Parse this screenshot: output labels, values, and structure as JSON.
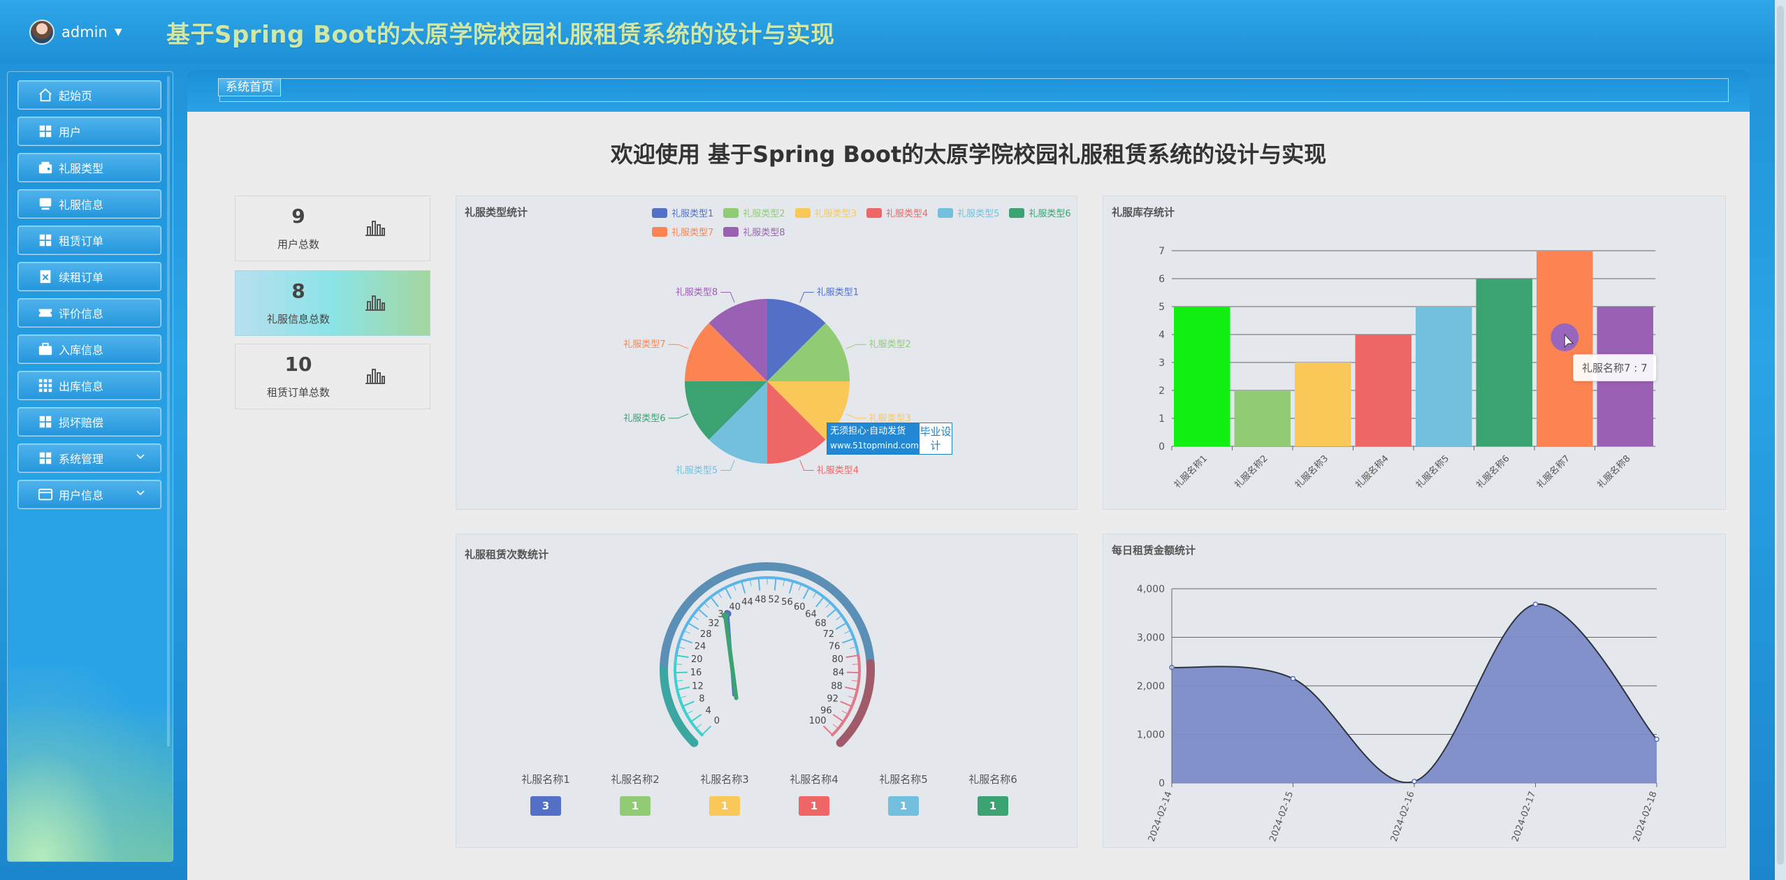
{
  "header": {
    "username": "admin",
    "title": "基于Spring Boot的太原学院校园礼服租赁系统的设计与实现"
  },
  "sidebar": {
    "items": [
      {
        "label": "起始页",
        "icon": "home-icon"
      },
      {
        "label": "用户",
        "icon": "grid-icon"
      },
      {
        "label": "礼服类型",
        "icon": "wallet-icon"
      },
      {
        "label": "礼服信息",
        "icon": "monitor-icon"
      },
      {
        "label": "租赁订单",
        "icon": "grid-icon"
      },
      {
        "label": "续租订单",
        "icon": "document-x-icon"
      },
      {
        "label": "评价信息",
        "icon": "ticket-icon"
      },
      {
        "label": "入库信息",
        "icon": "briefcase-icon"
      },
      {
        "label": "出库信息",
        "icon": "apps-icon"
      },
      {
        "label": "损坏赔偿",
        "icon": "grid-icon"
      },
      {
        "label": "系统管理",
        "icon": "grid-icon",
        "expandable": true
      },
      {
        "label": "用户信息",
        "icon": "card-icon",
        "expandable": true
      }
    ]
  },
  "breadcrumb": "系统首页",
  "welcome": "欢迎使用 基于Spring Boot的太原学院校园礼服租赁系统的设计与实现",
  "stats": [
    {
      "value": "9",
      "label": "用户总数"
    },
    {
      "value": "8",
      "label": "礼服信息总数"
    },
    {
      "value": "10",
      "label": "租赁订单总数"
    }
  ],
  "colors": {
    "blue": "#5470c6",
    "green": "#91cc75",
    "yellow": "#fac858",
    "red": "#ee6666",
    "cyan": "#73c0de",
    "teal": "#3ba272",
    "orange": "#fc8452",
    "purple": "#9a60b4",
    "bright_green": "#11ee11"
  },
  "panels": {
    "pie_title": "礼服类型统计",
    "bar_title": "礼服库存统计",
    "gauge_title": "礼服租赁次数统计",
    "area_title": "每日租赁金额统计"
  },
  "watermark": {
    "line1": "无须担心·自动发货",
    "line2": "www.51topmind.com",
    "badge": "毕业设计"
  },
  "tooltip": "礼服名称7 : 7",
  "chart_data": [
    {
      "type": "pie",
      "title": "礼服类型统计",
      "categories": [
        "礼服类型1",
        "礼服类型2",
        "礼服类型3",
        "礼服类型4",
        "礼服类型5",
        "礼服类型6",
        "礼服类型7",
        "礼服类型8"
      ],
      "values": [
        1,
        1,
        1,
        1,
        1,
        1,
        1,
        1
      ],
      "legend": "top-right"
    },
    {
      "type": "bar",
      "title": "礼服库存统计",
      "categories": [
        "礼服名称1",
        "礼服名称2",
        "礼服名称3",
        "礼服名称4",
        "礼服名称5",
        "礼服名称6",
        "礼服名称7",
        "礼服名称8"
      ],
      "values": [
        5,
        2,
        3,
        4,
        5,
        6,
        7,
        5
      ],
      "ylim": [
        0,
        7
      ],
      "yticks": [
        0,
        1,
        2,
        3,
        4,
        5,
        6,
        7
      ],
      "grid": true
    },
    {
      "type": "gauge",
      "title": "礼服租赁次数统计",
      "categories": [
        "礼服名称1",
        "礼服名称2",
        "礼服名称3",
        "礼服名称4",
        "礼服名称5",
        "礼服名称6"
      ],
      "values": [
        3,
        1,
        1,
        1,
        1,
        1
      ],
      "range": [
        0,
        100
      ],
      "ticks": [
        0,
        4,
        8,
        12,
        16,
        20,
        24,
        28,
        32,
        36,
        40,
        44,
        48,
        52,
        56,
        60,
        64,
        68,
        72,
        76,
        80,
        84,
        88,
        92,
        96,
        100
      ]
    },
    {
      "type": "area",
      "title": "每日租赁金额统计",
      "x": [
        "2024-02-14",
        "2024-02-15",
        "2024-02-16",
        "2024-02-17",
        "2024-02-18"
      ],
      "values": [
        2380,
        2150,
        30,
        3680,
        900
      ],
      "ylim": [
        0,
        4000
      ],
      "yticks": [
        "0",
        "1,000",
        "2,000",
        "3,000",
        "4,000"
      ],
      "grid": true
    }
  ]
}
